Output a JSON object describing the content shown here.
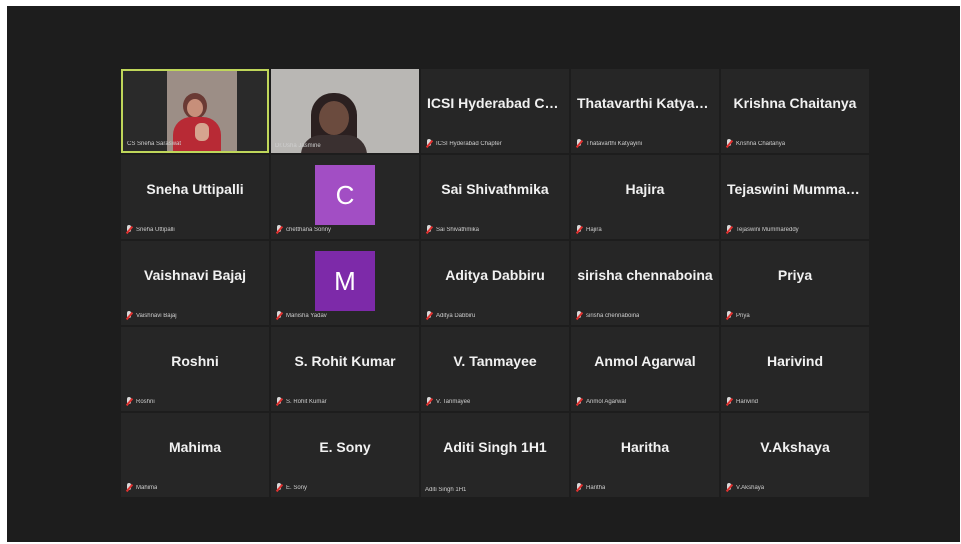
{
  "colors": {
    "background": "#1d1d1d",
    "tile": "#262626",
    "active_border": "#bfd65a",
    "muted_icon": "#e0312f"
  },
  "participants": [
    {
      "name": "",
      "caption": "CS Sneha Saraswat",
      "video": "v1",
      "active": true
    },
    {
      "name": "",
      "caption": "Dr.Usha Jasmine",
      "video": "v2"
    },
    {
      "name": "ICSI Hyderabad Chapter",
      "caption": "ICSI Hyderabad Chapter",
      "muted": true
    },
    {
      "name": "Thatavarthi Katyayini",
      "caption": "Thatavarthi Katyayini",
      "muted": true
    },
    {
      "name": "Krishna Chaitanya",
      "caption": "Krishna Chaitanya",
      "muted": true
    },
    {
      "name": "Sneha Uttipalli",
      "caption": "Sneha Uttipalli",
      "muted": true
    },
    {
      "name": "",
      "caption": "chetthana Sonny",
      "muted": true,
      "avatar": "C",
      "avatar_color": "#a24ec4"
    },
    {
      "name": "Sai Shivathmika",
      "caption": "Sai Shivathmika",
      "muted": true
    },
    {
      "name": "Hajira",
      "caption": "Hajira",
      "muted": true
    },
    {
      "name": "Tejaswini Mummareddy",
      "caption": "Tejaswini Mummareddy",
      "muted": true
    },
    {
      "name": "Vaishnavi Bajaj",
      "caption": "Vaishnavi Bajaj",
      "muted": true
    },
    {
      "name": "",
      "caption": "Manisha Yadav",
      "muted": true,
      "avatar": "M",
      "avatar_color": "#7d2aa9"
    },
    {
      "name": "Aditya Dabbiru",
      "caption": "Aditya Dabbiru",
      "muted": true
    },
    {
      "name": "sirisha chennaboina",
      "caption": "sirisha chennaboina",
      "muted": true
    },
    {
      "name": "Priya",
      "caption": "Priya",
      "muted": true
    },
    {
      "name": "Roshni",
      "caption": "Roshni",
      "muted": true
    },
    {
      "name": "S. Rohit Kumar",
      "caption": "S. Rohit Kumar",
      "muted": true
    },
    {
      "name": "V. Tanmayee",
      "caption": "V. Tanmayee",
      "muted": true
    },
    {
      "name": "Anmol Agarwal",
      "caption": "Anmol Agarwal",
      "muted": true
    },
    {
      "name": "Harivind",
      "caption": "Harivind",
      "muted": true
    },
    {
      "name": "Mahima",
      "caption": "Mahima",
      "muted": true
    },
    {
      "name": "E. Sony",
      "caption": "E. Sony",
      "muted": true
    },
    {
      "name": "Aditi Singh 1H1",
      "caption": "Aditi Singh 1H1",
      "muted": false
    },
    {
      "name": "Haritha",
      "caption": "Haritha",
      "muted": true
    },
    {
      "name": "V.Akshaya",
      "caption": "V.Akshaya",
      "muted": true
    }
  ]
}
